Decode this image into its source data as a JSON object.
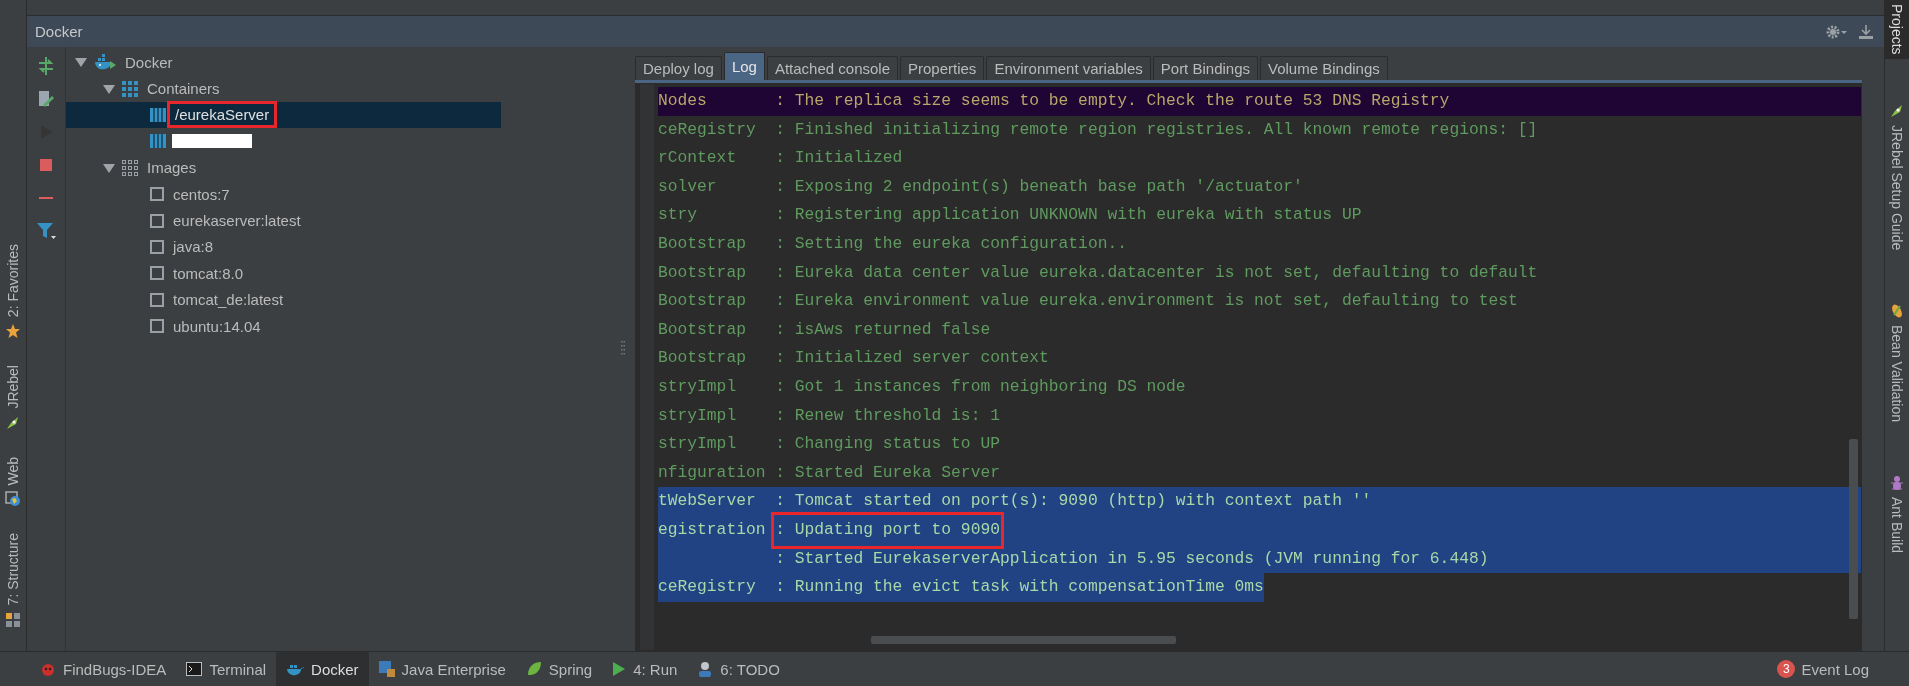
{
  "window": {
    "title": "Docker"
  },
  "left_strip": [
    {
      "label": "2: Favorites"
    },
    {
      "label": "JRebel"
    },
    {
      "label": "Web"
    },
    {
      "label": "7: Structure"
    }
  ],
  "right_strip": [
    {
      "label": "Projects",
      "selected": true
    },
    {
      "label": "JRebel Setup Guide",
      "selected": false
    },
    {
      "label": "Bean Validation",
      "selected": false
    },
    {
      "label": "Ant Build",
      "selected": false
    }
  ],
  "toolbar": [
    {
      "kind": "deploy",
      "disabled": false
    },
    {
      "kind": "edit",
      "disabled": false
    },
    {
      "kind": "run",
      "disabled": true
    },
    {
      "kind": "stop",
      "disabled": false
    },
    {
      "kind": "remove",
      "disabled": false
    },
    {
      "kind": "filter",
      "disabled": false
    }
  ],
  "tree": {
    "label": "Docker",
    "kind": "root",
    "expanded": true,
    "selected": false,
    "children": [
      {
        "label": "Containers",
        "kind": "containers",
        "expanded": true,
        "selected": false,
        "children": [
          {
            "label": "/eurekaServer",
            "kind": "container",
            "selected": true,
            "annotated": true
          },
          {
            "kind": "container",
            "selected": false,
            "redacted": true
          }
        ]
      },
      {
        "label": "Images",
        "kind": "images",
        "expanded": true,
        "selected": false,
        "children": [
          {
            "label": "centos:7",
            "kind": "image",
            "selected": false
          },
          {
            "label": "eurekaserver:latest",
            "kind": "image",
            "selected": false
          },
          {
            "label": "java:8",
            "kind": "image",
            "selected": false
          },
          {
            "label": "tomcat:8.0",
            "kind": "image",
            "selected": false
          },
          {
            "label": "tomcat_de:latest",
            "kind": "image",
            "selected": false
          },
          {
            "label": "ubuntu:14.04",
            "kind": "image",
            "selected": false
          }
        ]
      }
    ]
  },
  "tabs": [
    {
      "label": "Deploy log",
      "selected": false
    },
    {
      "label": "Log",
      "selected": true
    },
    {
      "label": "Attached console",
      "selected": false
    },
    {
      "label": "Properties",
      "selected": false
    },
    {
      "label": "Environment variables",
      "selected": false
    },
    {
      "label": "Port Bindings",
      "selected": false
    },
    {
      "label": "Volume Bindings",
      "selected": false
    }
  ],
  "log": {
    "lines": [
      {
        "source": "Nodes",
        "message": ": The replica size seems to be empty. Check the route 53 DNS Registry",
        "kind": "warning",
        "selected": false
      },
      {
        "source": "ceRegistry",
        "message": ": Finished initializing remote region registries. All known remote regions: []",
        "kind": "info",
        "selected": false
      },
      {
        "source": "rContext",
        "message": ": Initialized",
        "kind": "info",
        "selected": false
      },
      {
        "source": "solver",
        "message": ": Exposing 2 endpoint(s) beneath base path '/actuator'",
        "kind": "info",
        "selected": false
      },
      {
        "source": "stry",
        "message": ": Registering application UNKNOWN with eureka with status UP",
        "kind": "info",
        "selected": false
      },
      {
        "source": "Bootstrap",
        "message": ": Setting the eureka configuration..",
        "kind": "info",
        "selected": false
      },
      {
        "source": "Bootstrap",
        "message": ": Eureka data center value eureka.datacenter is not set, defaulting to default",
        "kind": "info",
        "selected": false
      },
      {
        "source": "Bootstrap",
        "message": ": Eureka environment value eureka.environment is not set, defaulting to test",
        "kind": "info",
        "selected": false
      },
      {
        "source": "Bootstrap",
        "message": ": isAws returned false",
        "kind": "info",
        "selected": false
      },
      {
        "source": "Bootstrap",
        "message": ": Initialized server context",
        "kind": "info",
        "selected": false
      },
      {
        "source": "stryImpl",
        "message": ": Got 1 instances from neighboring DS node",
        "kind": "info",
        "selected": false
      },
      {
        "source": "stryImpl",
        "message": ": Renew threshold is: 1",
        "kind": "info",
        "selected": false
      },
      {
        "source": "stryImpl",
        "message": ": Changing status to UP",
        "kind": "info",
        "selected": false
      },
      {
        "source": "nfiguration",
        "message": ": Started Eureka Server",
        "kind": "info",
        "selected": false
      },
      {
        "source": "tWebServer",
        "message": ": Tomcat started on port(s): 9090 (http) with context path ''",
        "kind": "info",
        "selected": true
      },
      {
        "source": "egistration",
        "message": ": Updating port to 9090",
        "kind": "info",
        "selected": true,
        "annotated": true
      },
      {
        "message": ": Started EurekaserverApplication in 5.95 seconds (JVM running for 6.448)",
        "kind": "info",
        "selected": true
      },
      {
        "source": "ceRegistry",
        "message": ": Running the evict task with compensationTime 0ms",
        "kind": "info",
        "selected": true
      }
    ]
  },
  "bottom_tabs": [
    {
      "label": "FindBugs-IDEA",
      "selected": false
    },
    {
      "label": "Terminal",
      "selected": false
    },
    {
      "label": "Docker",
      "selected": true
    },
    {
      "label": "Java Enterprise",
      "selected": false
    },
    {
      "label": "Spring",
      "selected": false
    },
    {
      "label": "4: Run",
      "selected": false
    },
    {
      "label": "6: TODO",
      "selected": false
    }
  ],
  "event_log": {
    "count": "3",
    "label": "Event Log"
  }
}
